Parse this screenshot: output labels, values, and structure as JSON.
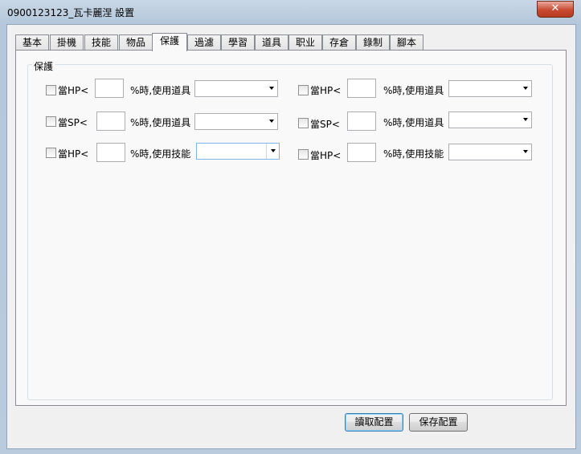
{
  "window": {
    "title": "0900123123_瓦卡麗涅  設置",
    "close_label": "✕"
  },
  "tabs": [
    "基本",
    "掛機",
    "技能",
    "物品",
    "保護",
    "過濾",
    "學習",
    "道具",
    "职业",
    "存倉",
    "錄制",
    "腳本"
  ],
  "active_tab": "保護",
  "group": {
    "title": "保護"
  },
  "rows": [
    {
      "check_label": "當HP<",
      "mid_label": "%時,使用道具"
    },
    {
      "check_label": "當HP<",
      "mid_label": "%時,使用道具"
    },
    {
      "check_label": "當SP<",
      "mid_label": "%時,使用道具"
    },
    {
      "check_label": "當SP<",
      "mid_label": "%時,使用道具"
    },
    {
      "check_label": "當HP<",
      "mid_label": "%時,使用技能"
    },
    {
      "check_label": "當HP<",
      "mid_label": "%時,使用技能"
    }
  ],
  "buttons": {
    "load": "讀取配置",
    "save": "保存配置"
  }
}
